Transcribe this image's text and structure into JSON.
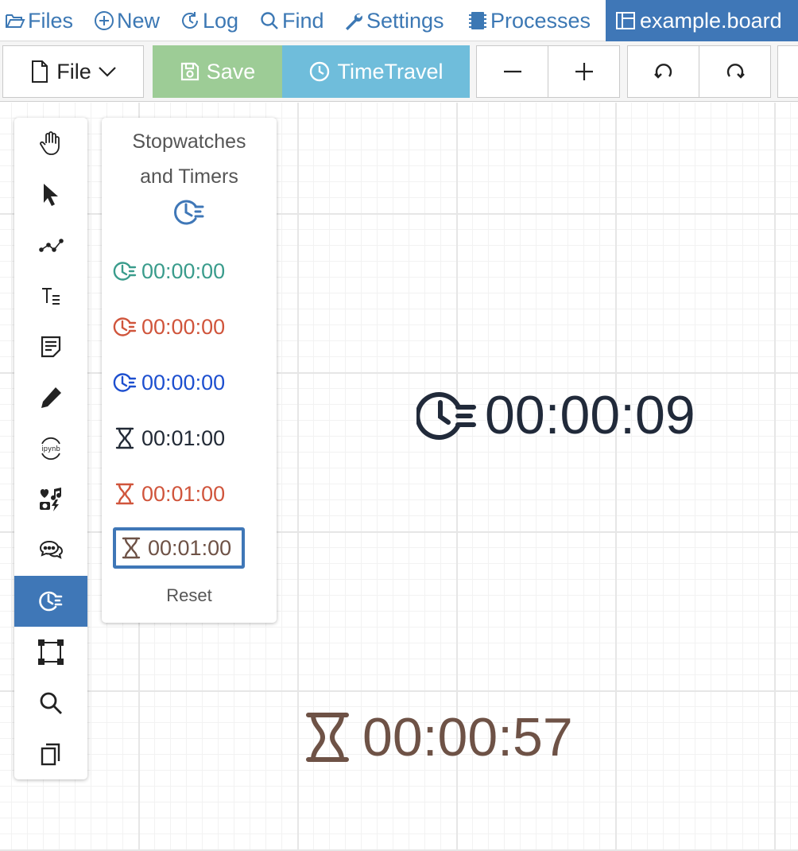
{
  "nav": {
    "items": [
      {
        "label": "Files",
        "icon": "folder-open-icon"
      },
      {
        "label": "New",
        "icon": "plus-circle-icon"
      },
      {
        "label": "Log",
        "icon": "history-icon"
      },
      {
        "label": "Find",
        "icon": "search-icon"
      },
      {
        "label": "Settings",
        "icon": "wrench-icon"
      },
      {
        "label": "Processes",
        "icon": "memory-icon"
      }
    ],
    "active_tab": {
      "label": "example.board",
      "icon": "board-icon"
    }
  },
  "toolbar": {
    "file_label": "File",
    "save_label": "Save",
    "timetravel_label": "TimeTravel",
    "colors": {
      "save": "#9dcc96",
      "timetravel": "#6fbddb"
    }
  },
  "palette": {
    "tools": [
      {
        "name": "hand-icon"
      },
      {
        "name": "pointer-icon"
      },
      {
        "name": "connector-icon"
      },
      {
        "name": "text-icon"
      },
      {
        "name": "note-icon"
      },
      {
        "name": "pencil-icon"
      },
      {
        "name": "ipynb-icon"
      },
      {
        "name": "media-icon"
      },
      {
        "name": "comments-icon"
      },
      {
        "name": "stopwatch-icon",
        "active": true
      },
      {
        "name": "frame-icon"
      },
      {
        "name": "zoom-icon"
      },
      {
        "name": "pages-icon"
      }
    ],
    "ipynb_text": "ipynb",
    "active_color": "#3f77b7"
  },
  "panel": {
    "title_line1": "Stopwatches",
    "title_line2": "and Timers",
    "items": [
      {
        "kind": "stopwatch",
        "value": "00:00:00",
        "color": "#3a9c8c"
      },
      {
        "kind": "stopwatch",
        "value": "00:00:00",
        "color": "#d0553c"
      },
      {
        "kind": "stopwatch",
        "value": "00:00:00",
        "color": "#1d4fcf"
      },
      {
        "kind": "timer",
        "value": "00:01:00",
        "color": "#222a36"
      },
      {
        "kind": "timer",
        "value": "00:01:00",
        "color": "#d0553c"
      },
      {
        "kind": "timer",
        "value": "00:01:00",
        "color": "#6e5246",
        "selected": true
      }
    ],
    "reset_label": "Reset"
  },
  "canvas": {
    "stopwatch": {
      "value": "00:00:09",
      "color": "#212a3a"
    },
    "timer": {
      "value": "00:00:57",
      "color": "#6e5246"
    }
  }
}
